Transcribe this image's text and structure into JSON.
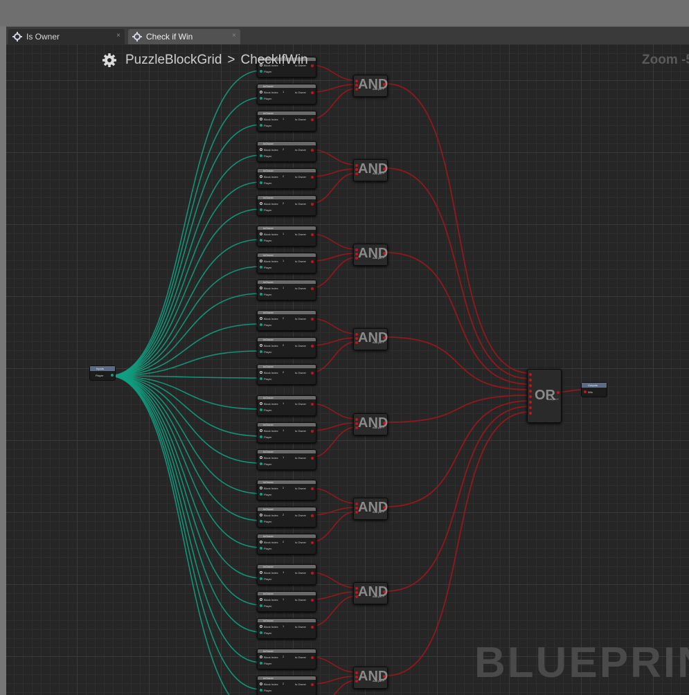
{
  "tabs": [
    {
      "label": "Is Owner",
      "close": "×",
      "icon": "blueprint-function-icon"
    },
    {
      "label": "Check if Win",
      "close": "×",
      "icon": "blueprint-function-icon"
    }
  ],
  "active_tab": 1,
  "breadcrumb": {
    "icon": "gear-icon",
    "items": [
      "PuzzleBlockGrid",
      "CheckIfWin"
    ],
    "separator": ">"
  },
  "zoom": "Zoom -5",
  "watermark": "BLUEPRINT",
  "colors": {
    "exec_wire_teal": "#11a081",
    "bool_wire_red": "#a0161b",
    "graph_bg": "#262626"
  },
  "input_node": {
    "title": "Inputs",
    "pin": "Player"
  },
  "output_node": {
    "title": "Outputs",
    "pin": "Win"
  },
  "isowner_node": {
    "title": "IsOwner",
    "pin_block": "Block Index",
    "pin_player": "Player",
    "pin_out": "Is Owner"
  },
  "and_node": {
    "label": "AND",
    "add_pin": "Add pin"
  },
  "or_node": {
    "label": "OR",
    "add_pin": "Add pin"
  },
  "groups": [
    {
      "indices": [
        "?",
        "?",
        "?"
      ]
    },
    {
      "indices": [
        "?",
        "?",
        "?"
      ]
    },
    {
      "indices": [
        "?",
        "?",
        "?"
      ]
    },
    {
      "indices": [
        "?",
        "?",
        "?"
      ]
    },
    {
      "indices": [
        "?",
        "?",
        "?"
      ]
    },
    {
      "indices": [
        "?",
        "?",
        "?"
      ]
    },
    {
      "indices": [
        "?",
        "?",
        "?"
      ]
    },
    {
      "indices": [
        "?",
        "?",
        "?"
      ]
    }
  ]
}
